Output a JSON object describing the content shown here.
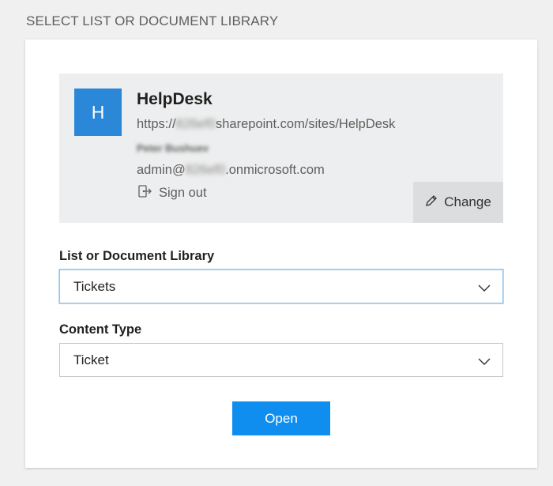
{
  "header": {
    "title": "SELECT LIST OR DOCUMENT LIBRARY"
  },
  "site": {
    "avatar_letter": "H",
    "name": "HelpDesk",
    "url_prefix": "https://",
    "url_redacted": "826ef0",
    "url_suffix": "sharepoint.com/sites/HelpDesk",
    "user_name": "Peter Bushuev",
    "email_prefix": "admin@",
    "email_redacted": "826ef0",
    "email_suffix": ".onmicrosoft.com",
    "sign_out_label": "Sign out",
    "change_label": "Change",
    "avatar_color": "#2b88d8"
  },
  "list_field": {
    "label": "List or Document Library",
    "value": "Tickets"
  },
  "content_type_field": {
    "label": "Content Type",
    "value": "Ticket"
  },
  "actions": {
    "open_label": "Open",
    "open_color": "#0f8ef0"
  },
  "icons": {
    "sign_out": "sign-out-icon",
    "change": "pencil-icon",
    "dropdown": "chevron-down-icon"
  }
}
